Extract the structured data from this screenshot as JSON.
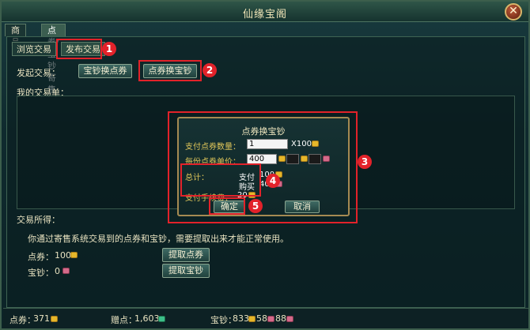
{
  "window": {
    "title": "仙缘宝阁",
    "close_label": "✕"
  },
  "top_tabs": [
    {
      "label": "商品"
    },
    {
      "label": "点券/宝钞寄售"
    }
  ],
  "sub_tabs": [
    {
      "label": "浏览交易"
    },
    {
      "label": "发布交易"
    }
  ],
  "initiate": {
    "label": "发起交易：",
    "btn_baochao_to_dianquan": "宝钞换点券",
    "btn_dianquan_to_baochao": "点券换宝钞"
  },
  "my_trades_label": "我的交易单：",
  "dialog": {
    "title": "点券换宝钞",
    "pay_qty_label": "支付点券数量：",
    "pay_qty_value": "1",
    "pay_qty_unit": "X100",
    "unit_price_label": "每份点券单价：",
    "unit_price_value": "400",
    "total_label": "总计：",
    "total_pay_label": "支付",
    "total_pay_value": "100",
    "total_buy_label": "购买",
    "total_buy_value": "400",
    "fee_label": "支付手续费：",
    "fee_value": "20",
    "confirm": "确定",
    "cancel": "取消"
  },
  "badges": {
    "b1": "1",
    "b2": "2",
    "b3": "3",
    "b4": "4",
    "b5": "5"
  },
  "proceeds": {
    "label": "交易所得：",
    "notice": "你通过寄售系统交易到的点券和宝钞，需要提取出来才能正常使用。",
    "dianquan_label": "点券：",
    "dianquan_value": "100",
    "baochao_label": "宝钞：",
    "baochao_value": "0",
    "btn_extract_dianquan": "提取点券",
    "btn_extract_baochao": "提取宝钞"
  },
  "bottom": {
    "dianquan_label": "点券：",
    "dianquan_value": "371",
    "zengdian_label": "赠点：",
    "zengdian_value": "1,603",
    "baochao_label": "宝钞：",
    "baochao_v1": "833",
    "baochao_v2": "58",
    "baochao_v3": "88"
  },
  "colors": {
    "highlight": "#e2222a",
    "gold": "#e3c95a",
    "panel": "#0f2a2e"
  }
}
